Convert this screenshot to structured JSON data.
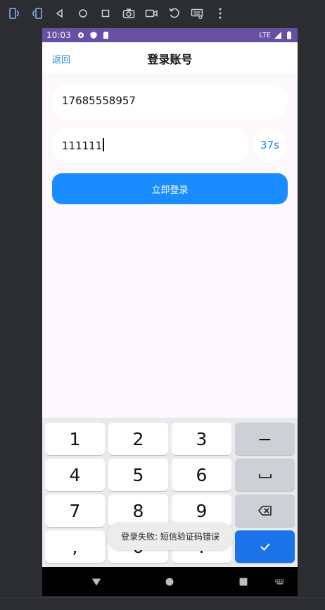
{
  "status_bar": {
    "time": "10:03",
    "network": "LTE"
  },
  "app_bar": {
    "back_label": "返回",
    "title": "登录账号"
  },
  "form": {
    "phone_value": "17685558957",
    "code_value": "111111",
    "countdown": "37s",
    "login_label": "立即登录"
  },
  "keyboard": {
    "keys": [
      "1",
      "2",
      "3",
      "−",
      "4",
      "5",
      "6",
      "␣",
      "7",
      "8",
      "9",
      "⌫",
      ",",
      "0",
      ".",
      "✓"
    ]
  },
  "toast": {
    "message": "登录失败: 短信验证码错误"
  },
  "colors": {
    "accent": "#1a8cff",
    "status_bar": "#6750a4",
    "link": "#1e88e5"
  }
}
